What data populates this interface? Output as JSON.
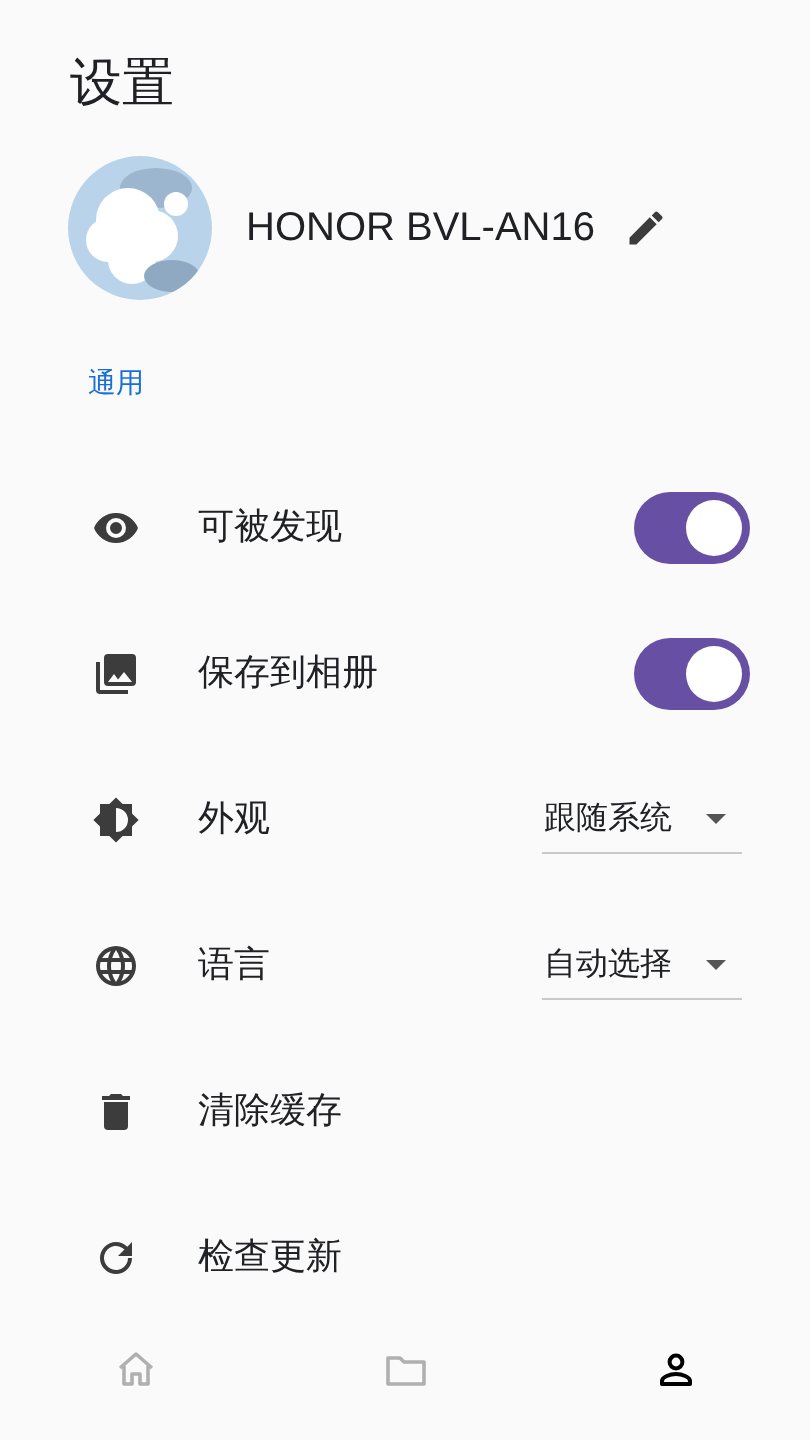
{
  "header": {
    "title": "设置"
  },
  "profile": {
    "device_name": "HONOR BVL-AN16"
  },
  "section": {
    "title": "通用"
  },
  "settings": [
    {
      "kind": "toggle",
      "label": "可被发现",
      "on": true
    },
    {
      "kind": "toggle",
      "label": "保存到相册",
      "on": true
    },
    {
      "kind": "dropdown",
      "label": "外观",
      "value": "跟随系统"
    },
    {
      "kind": "dropdown",
      "label": "语言",
      "value": "自动选择"
    },
    {
      "kind": "action",
      "label": "清除缓存"
    },
    {
      "kind": "action",
      "label": "检查更新"
    }
  ],
  "bottom_nav": [
    {
      "selected": false
    },
    {
      "selected": false
    },
    {
      "selected": true
    }
  ]
}
